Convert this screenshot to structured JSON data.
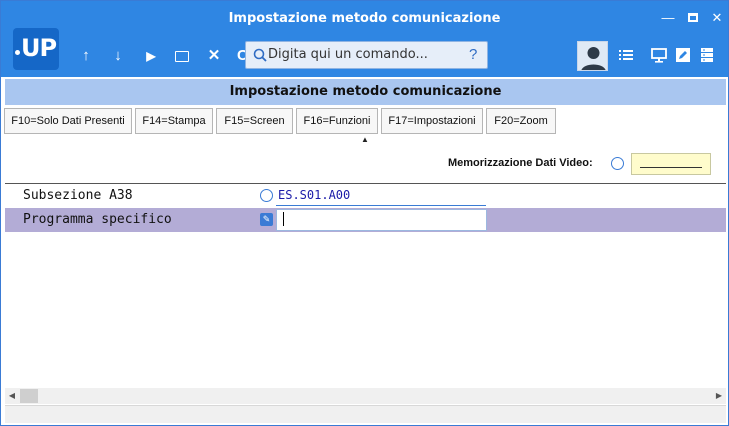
{
  "window": {
    "title": "Impostazione metodo comunicazione",
    "controls": {
      "minimize": "—",
      "close": "✕"
    }
  },
  "logo": {
    "text": "UP"
  },
  "toolbar": {
    "up_icon": "↑",
    "down_icon": "↓",
    "play_icon": "▶",
    "close_icon": "✕",
    "partial_icon": "C"
  },
  "search": {
    "placeholder": "Digita qui un comando...",
    "help": "?"
  },
  "section": {
    "title": "Impostazione metodo comunicazione"
  },
  "function_keys": [
    {
      "label": "F10=Solo Dati Presenti"
    },
    {
      "label": "F14=Stampa"
    },
    {
      "label": "F15=Screen"
    },
    {
      "label": "F16=Funzioni"
    },
    {
      "label": "F17=Impostazioni"
    },
    {
      "label": "F20=Zoom"
    }
  ],
  "memo": {
    "label": "Memorizzazione Dati Video:"
  },
  "rows": [
    {
      "label": "Subsezione A38",
      "value": "ES.S01.A00"
    },
    {
      "label": "Programma specifico",
      "value": ""
    }
  ],
  "scrollbar": {
    "left": "◀",
    "right": "▶"
  },
  "colors": {
    "titlebar": "#2f86e3",
    "section_header": "#a9c6f0",
    "selected_row": "#b3acd6",
    "memo_field": "#fffccc"
  }
}
